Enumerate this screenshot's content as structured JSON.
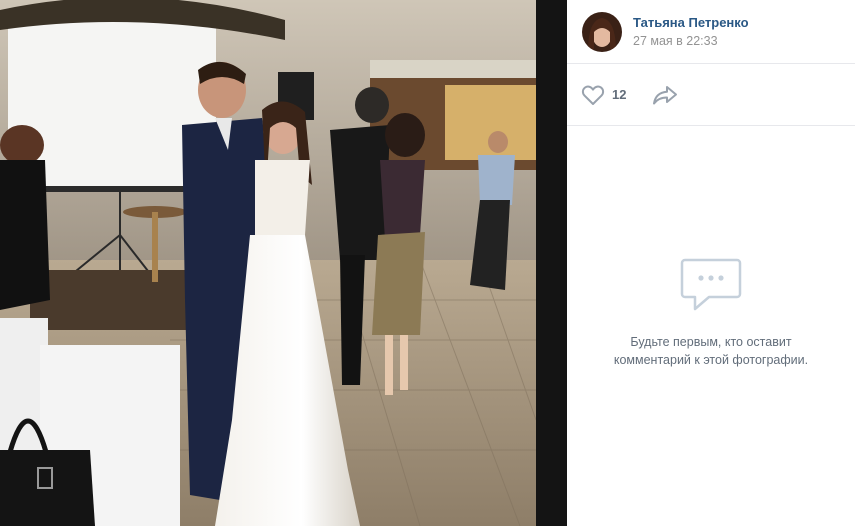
{
  "author": {
    "name": "Татьяна Петренко",
    "date": "27 мая в 22:33"
  },
  "actions": {
    "like_count": "12",
    "like_icon": "heart-outline-icon",
    "share_icon": "share-arrow-icon"
  },
  "comments": {
    "empty_icon": "comments-bubble-icon",
    "empty_line1": "Будьте первым, кто оставит",
    "empty_line2": "комментарий к этой фотографии."
  },
  "colors": {
    "link": "#2a5885",
    "muted": "#939393",
    "icon": "#99a2ad",
    "text_secondary": "#626d7a",
    "separator": "#e7e8ec"
  }
}
